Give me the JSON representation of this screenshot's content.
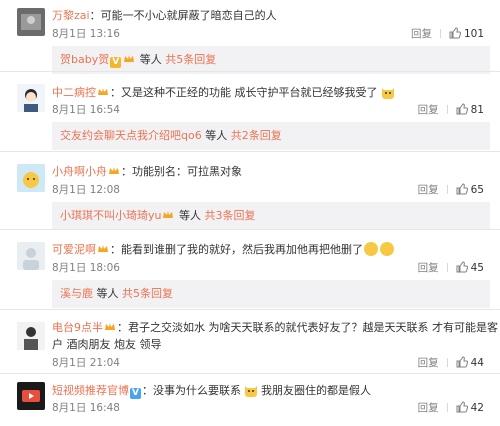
{
  "comments": [
    {
      "user": "万黎zai",
      "text": "：可能一不小心就屏蔽了暗恋自己的人",
      "time": "8月1日 13:16",
      "reply": "回复",
      "likes": "101",
      "sub": {
        "user": "贺baby贺",
        "mid": " 等人 ",
        "more": "共5条回复"
      }
    },
    {
      "user": "中二病控",
      "text": "：又是这种不正经的功能 成长守护平台就已经够我受了",
      "time": "8月1日 16:54",
      "reply": "回复",
      "likes": "81",
      "sub": {
        "user": "交友约会聊天点我介绍吧qo6",
        "mid": " 等人 ",
        "more": "共2条回复"
      }
    },
    {
      "user": "小舟啊小舟",
      "text": "：功能别名：可拉黑对象",
      "time": "8月1日 12:08",
      "reply": "回复",
      "likes": "65",
      "sub": {
        "user": "小琪琪不叫小琦琦yu",
        "mid": " 等人 ",
        "more": "共3条回复"
      }
    },
    {
      "user": "可爱泥啊",
      "text": "：能看到谁删了我的就好，然后我再加他再把他删了",
      "time": "8月1日 18:06",
      "reply": "回复",
      "likes": "45",
      "sub": {
        "user": "溪与鹿",
        "mid": " 等人 ",
        "more": "共5条回复"
      }
    },
    {
      "user": "电台9点半",
      "text": "：君子之交淡如水  为啥天天联系的就代表好友了？越是天天联系  才有可能是客",
      "text2": "户  酒肉朋友  炮友  领导",
      "time": "8月1日 21:04",
      "reply": "回复",
      "likes": "44"
    },
    {
      "user": "短视频推荐官博",
      "text": "：没事为什么要联系",
      "text_b": "我朋友圈住的都是假人",
      "time": "8月1日 16:48",
      "reply": "回复",
      "likes": "42"
    }
  ],
  "icons": {
    "verified": "V",
    "thumb": "thumbs-up-icon"
  }
}
